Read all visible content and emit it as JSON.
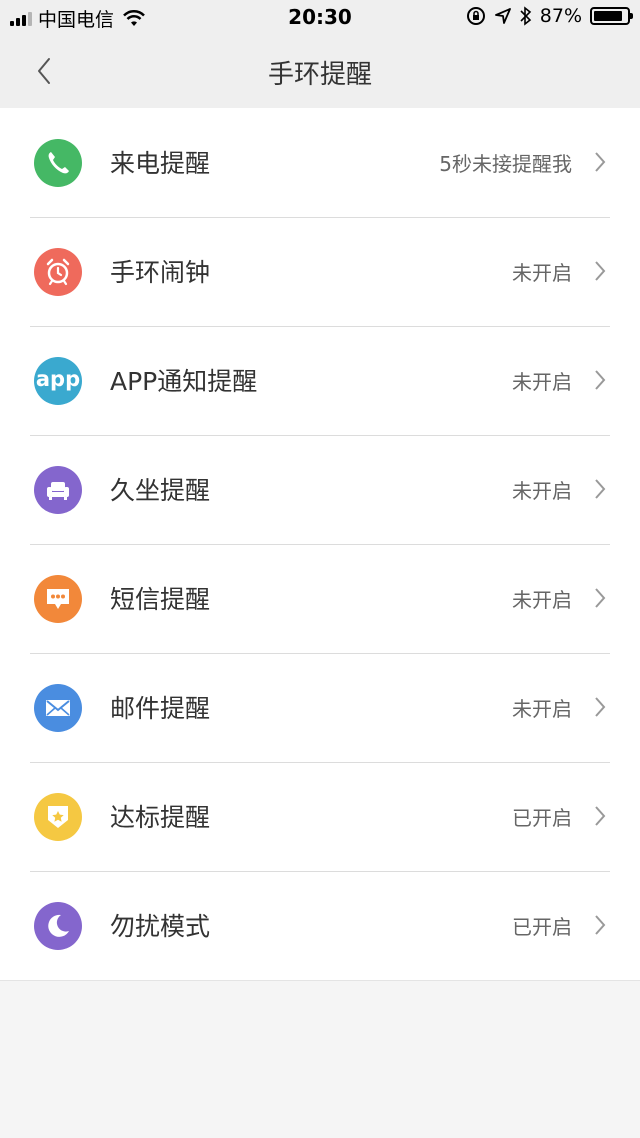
{
  "status_bar": {
    "carrier": "中国电信",
    "time": "20:30",
    "battery": "87%",
    "battery_level": 0.87,
    "icons": [
      "signal-icon",
      "wifi-icon",
      "orientation-lock-icon",
      "location-icon",
      "bluetooth-icon",
      "battery-icon"
    ]
  },
  "nav": {
    "title": "手环提醒",
    "back_icon": "chevron-left-icon"
  },
  "items": [
    {
      "label": "来电提醒",
      "status": "5秒未接提醒我",
      "icon": "phone-icon",
      "color": "#45b865"
    },
    {
      "label": "手环闹钟",
      "status": "未开启",
      "icon": "alarm-clock-icon",
      "color": "#ef6a5c"
    },
    {
      "label": "APP通知提醒",
      "status": "未开启",
      "icon": "app-icon",
      "color": "#3aa9cf",
      "icon_text": "app"
    },
    {
      "label": "久坐提醒",
      "status": "未开启",
      "icon": "sofa-icon",
      "color": "#8466cd"
    },
    {
      "label": "短信提醒",
      "status": "未开启",
      "icon": "message-icon",
      "color": "#f2883a"
    },
    {
      "label": "邮件提醒",
      "status": "未开启",
      "icon": "mail-icon",
      "color": "#4a8de0"
    },
    {
      "label": "达标提醒",
      "status": "已开启",
      "icon": "badge-star-icon",
      "color": "#f5c842"
    },
    {
      "label": "勿扰模式",
      "status": "已开启",
      "icon": "moon-icon",
      "color": "#8466cd"
    }
  ]
}
